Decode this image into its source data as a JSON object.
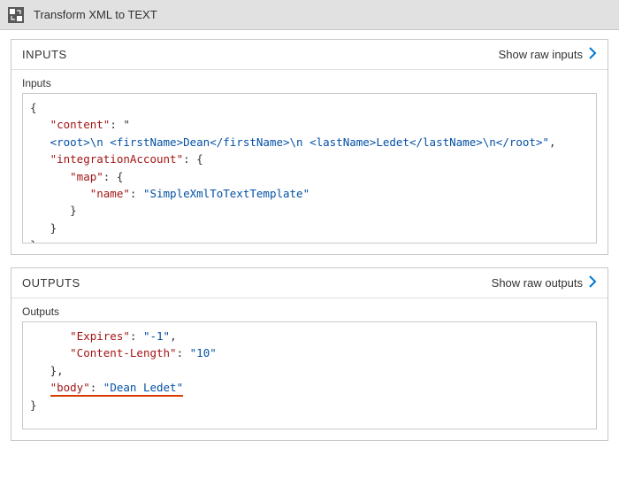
{
  "titlebar": {
    "title": "Transform XML to TEXT"
  },
  "inputs_panel": {
    "title": "INPUTS",
    "show_raw_label": "Show raw inputs",
    "sub_label": "Inputs",
    "code": {
      "open": "{",
      "content_key": "\"content\"",
      "content_colon": ": ",
      "content_open": "\"",
      "xml_line": "<root>\\n <firstName>Dean</firstName>\\n <lastName>Ledet</lastName>\\n</root>\"",
      "coma1": ",",
      "ia_key": "\"integrationAccount\"",
      "ia_open": ": {",
      "map_key": "\"map\"",
      "map_open": ": {",
      "name_key": "\"name\"",
      "name_colon": ": ",
      "name_val": "\"SimpleXmlToTextTemplate\"",
      "close3": "}",
      "close2": "}",
      "close1": "}"
    }
  },
  "outputs_panel": {
    "title": "OUTPUTS",
    "show_raw_label": "Show raw outputs",
    "sub_label": "Outputs",
    "code": {
      "expires_key": "\"Expires\"",
      "expires_val": "\"-1\"",
      "coma1": ",",
      "cl_key": "\"Content-Length\"",
      "cl_val": "\"10\"",
      "close_inner": "},",
      "body_key": "\"body\"",
      "body_colon": ": ",
      "body_val": "\"Dean Ledet\"",
      "close_outer": "}"
    }
  }
}
